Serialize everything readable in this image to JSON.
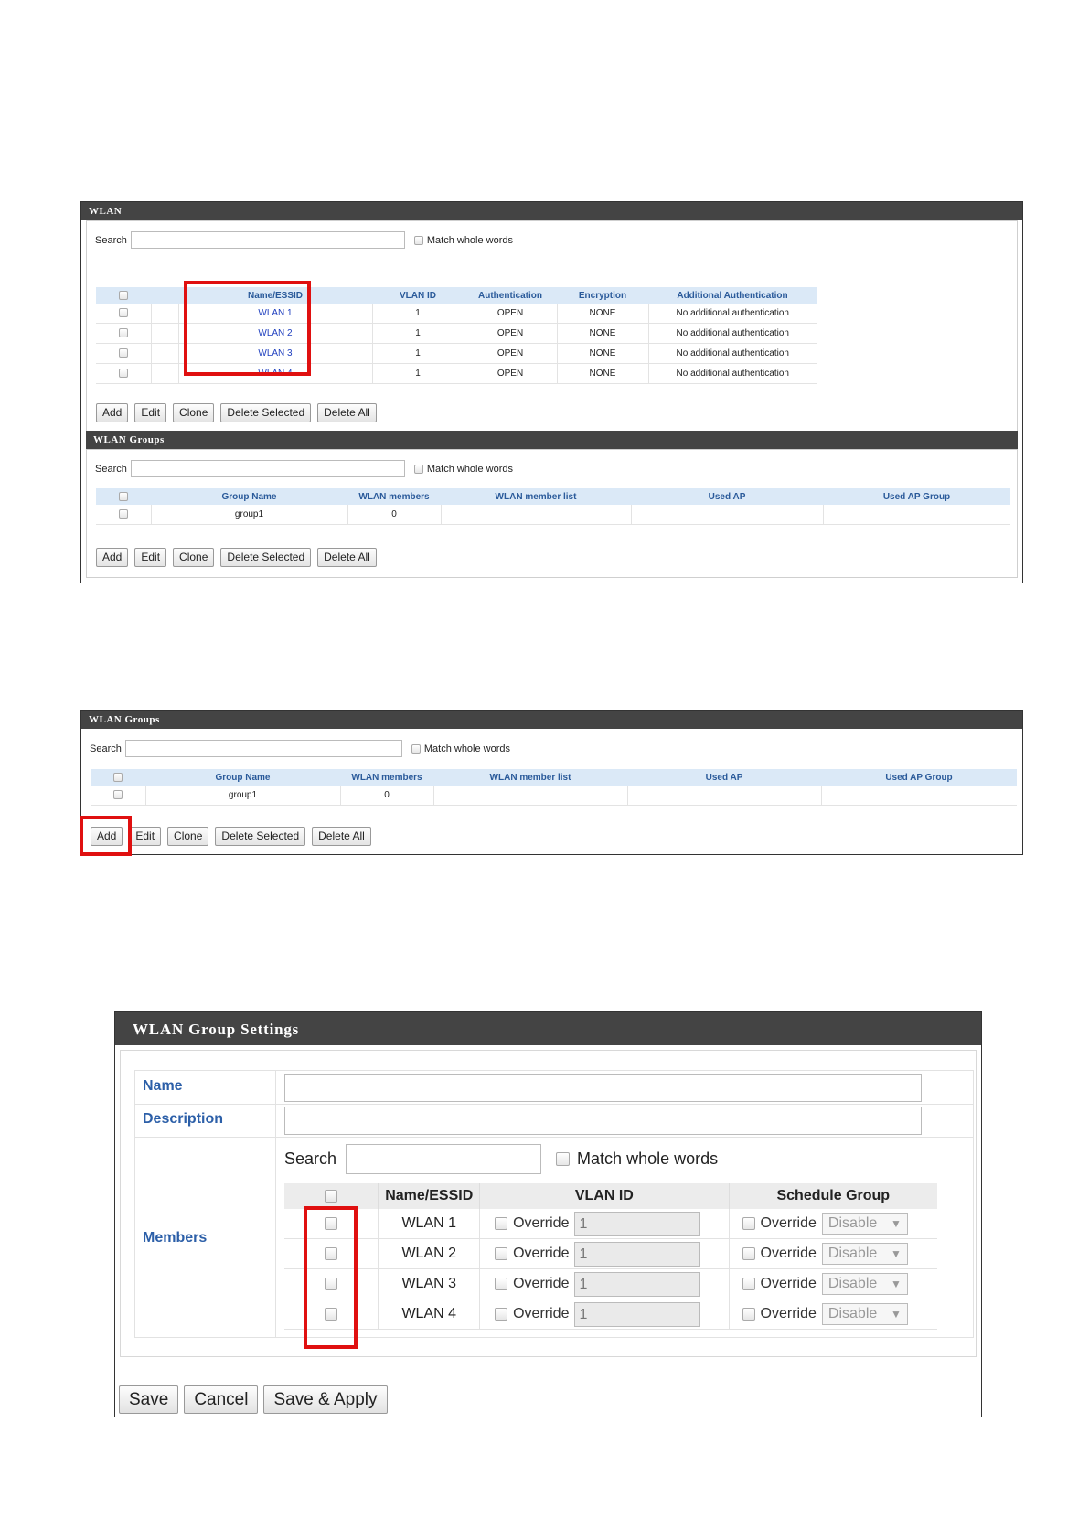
{
  "wlan_panel": {
    "title": "WLAN",
    "search_label": "Search",
    "match_label": "Match whole words",
    "columns": [
      "Name/ESSID",
      "VLAN ID",
      "Authentication",
      "Encryption",
      "Additional Authentication"
    ],
    "rows": [
      {
        "name": "WLAN 1",
        "vlan": "1",
        "auth": "OPEN",
        "enc": "NONE",
        "add": "No additional authentication"
      },
      {
        "name": "WLAN 2",
        "vlan": "1",
        "auth": "OPEN",
        "enc": "NONE",
        "add": "No additional authentication"
      },
      {
        "name": "WLAN 3",
        "vlan": "1",
        "auth": "OPEN",
        "enc": "NONE",
        "add": "No additional authentication"
      },
      {
        "name": "WLAN 4",
        "vlan": "1",
        "auth": "OPEN",
        "enc": "NONE",
        "add": "No additional authentication"
      }
    ],
    "buttons": [
      "Add",
      "Edit",
      "Clone",
      "Delete Selected",
      "Delete All"
    ]
  },
  "groups_panel": {
    "title": "WLAN Groups",
    "search_label": "Search",
    "match_label": "Match whole words",
    "columns": [
      "Group Name",
      "WLAN members",
      "WLAN member list",
      "Used AP",
      "Used AP Group"
    ],
    "rows": [
      {
        "group": "group1",
        "members": "0",
        "list": "",
        "ap": "",
        "apgroup": ""
      }
    ],
    "buttons": [
      "Add",
      "Edit",
      "Clone",
      "Delete Selected",
      "Delete All"
    ]
  },
  "settings_panel": {
    "title": "WLAN Group Settings",
    "name_label": "Name",
    "description_label": "Description",
    "members_label": "Members",
    "search_label": "Search",
    "match_label": "Match whole words",
    "columns": [
      "Name/ESSID",
      "VLAN ID",
      "Schedule Group"
    ],
    "override_label": "Override",
    "rows": [
      {
        "name": "WLAN 1",
        "vlan": "1",
        "schedule": "Disable"
      },
      {
        "name": "WLAN 2",
        "vlan": "1",
        "schedule": "Disable"
      },
      {
        "name": "WLAN 3",
        "vlan": "1",
        "schedule": "Disable"
      },
      {
        "name": "WLAN 4",
        "vlan": "1",
        "schedule": "Disable"
      }
    ],
    "buttons": [
      "Save",
      "Cancel",
      "Save & Apply"
    ]
  },
  "colors": {
    "highlight": "#e01010",
    "header": "#444444",
    "link": "#1f3fbf",
    "label": "#2c5fa8"
  }
}
